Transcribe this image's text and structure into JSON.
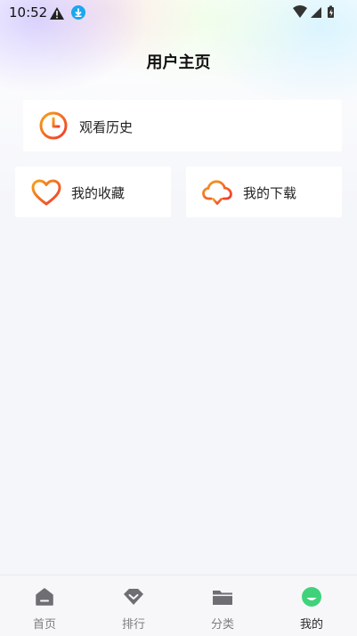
{
  "status_bar": {
    "time": "10:52",
    "icons": [
      "warning-icon",
      "download-notification-icon",
      "wifi-icon",
      "signal-icon",
      "battery-icon"
    ]
  },
  "header": {
    "title": "用户主页"
  },
  "cards": {
    "history": {
      "label": "观看历史",
      "icon": "clock-icon"
    },
    "favorites": {
      "label": "我的收藏",
      "icon": "heart-icon"
    },
    "downloads": {
      "label": "我的下载",
      "icon": "cloud-download-icon"
    }
  },
  "tabbar": {
    "tabs": [
      {
        "label": "首页",
        "icon": "home-icon",
        "active": false
      },
      {
        "label": "排行",
        "icon": "ranking-icon",
        "active": false
      },
      {
        "label": "分类",
        "icon": "folder-icon",
        "active": false
      },
      {
        "label": "我的",
        "icon": "profile-icon",
        "active": true
      }
    ]
  },
  "colors": {
    "accent_orange": "#f07a1a",
    "accent_red": "#f0452c",
    "active_tab_green": "#3fd27a",
    "inactive_tab_icon": "#6e6e73",
    "background": "#f5f6fa"
  }
}
